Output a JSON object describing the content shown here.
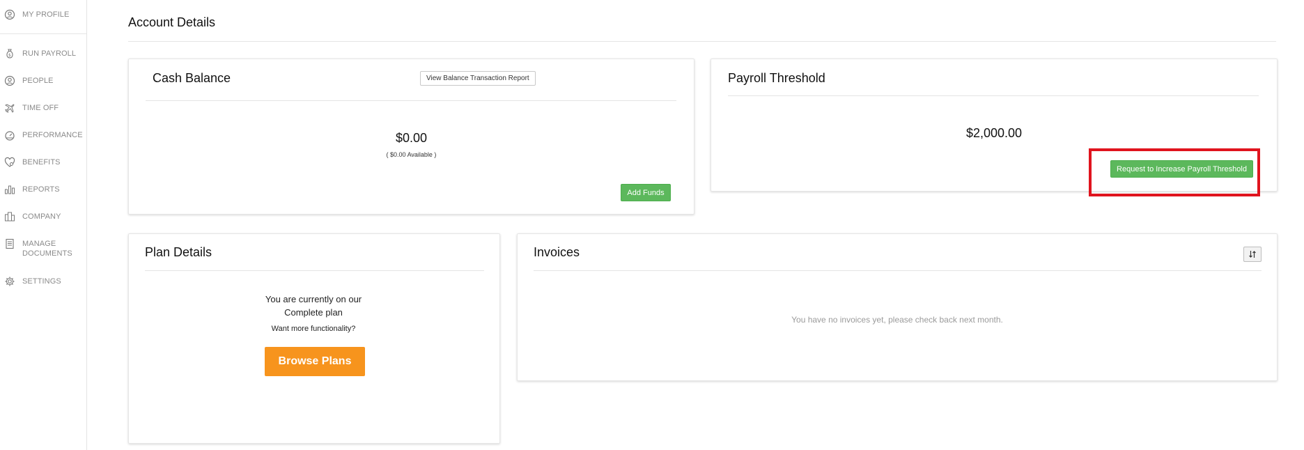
{
  "sidebar": {
    "items": [
      {
        "label": "MY PROFILE",
        "icon": "user-circle-icon"
      },
      {
        "label": "RUN PAYROLL",
        "icon": "money-bag-icon"
      },
      {
        "label": "PEOPLE",
        "icon": "people-icon"
      },
      {
        "label": "TIME OFF",
        "icon": "airplane-icon"
      },
      {
        "label": "PERFORMANCE",
        "icon": "gauge-icon"
      },
      {
        "label": "BENEFITS",
        "icon": "heart-icon"
      },
      {
        "label": "REPORTS",
        "icon": "bar-chart-icon"
      },
      {
        "label": "COMPANY",
        "icon": "building-icon"
      },
      {
        "label": "MANAGE",
        "label2": "DOCUMENTS",
        "icon": "document-icon"
      },
      {
        "label": "SETTINGS",
        "icon": "gear-icon"
      }
    ]
  },
  "main": {
    "page_title": "Account Details",
    "cash_balance": {
      "title": "Cash Balance",
      "report_button": "View Balance Transaction Report",
      "amount": "$0.00",
      "available": "( $0.00 Available )",
      "add_funds_button": "Add Funds"
    },
    "payroll_threshold": {
      "title": "Payroll Threshold",
      "amount": "$2,000.00",
      "request_button": "Request to Increase Payroll Threshold"
    },
    "plan_details": {
      "title": "Plan Details",
      "line1": "You are currently on our",
      "line2": "Complete plan",
      "line3": "Want more functionality?",
      "browse_button": "Browse Plans"
    },
    "invoices": {
      "title": "Invoices",
      "empty_message": "You have no invoices yet, please check back next month."
    }
  },
  "colors": {
    "green": "#5cb85c",
    "orange": "#f7941d",
    "highlight": "#e0141e"
  }
}
